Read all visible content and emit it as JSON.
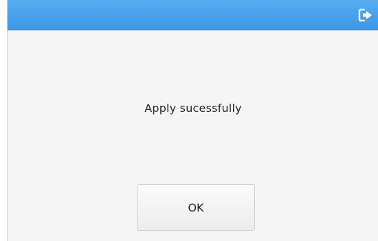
{
  "dialog": {
    "header": {
      "exit_icon": "exit-arrow-icon",
      "color": "#4aa2ec"
    },
    "message": "Apply sucessfully",
    "ok_label": "OK"
  }
}
